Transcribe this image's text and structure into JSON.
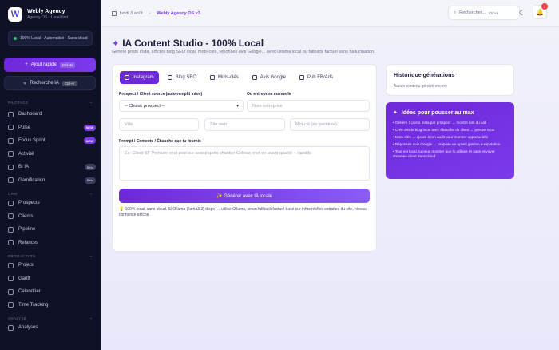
{
  "brand": {
    "logo_letter": "W",
    "name": "Webly Agency",
    "subtitle": "Agency OS · Local first"
  },
  "sidebar": {
    "status_pill": "100% Local · Automatisé · Sans cloud",
    "quick_add": {
      "label": "Ajout rapide",
      "shortcut": "Ctrl+N"
    },
    "ai_search": {
      "label": "Recherche IA",
      "shortcut": "Ctrl+K"
    },
    "sections": [
      {
        "title": "PILOTAGE",
        "items": [
          {
            "label": "Dashboard",
            "badge": ""
          },
          {
            "label": "Pulse",
            "badge": "NEW"
          },
          {
            "label": "Focus Sprint",
            "badge": "NEW"
          },
          {
            "label": "Activité",
            "badge": ""
          },
          {
            "label": "BI IA",
            "badge": "Bêta"
          },
          {
            "label": "Gamification",
            "badge": "Bêta"
          }
        ]
      },
      {
        "title": "CRM",
        "items": [
          {
            "label": "Prospects"
          },
          {
            "label": "Clients"
          },
          {
            "label": "Pipeline"
          },
          {
            "label": "Relances"
          }
        ]
      },
      {
        "title": "PRODUCTION",
        "items": [
          {
            "label": "Projets"
          },
          {
            "label": "Gantt"
          },
          {
            "label": "Calendrier"
          },
          {
            "label": "Time Tracking"
          }
        ]
      },
      {
        "title": "ANALYSE",
        "items": [
          {
            "label": "Analyses"
          }
        ]
      }
    ]
  },
  "topbar": {
    "date": "lundi 3 août",
    "separator": "•",
    "app": "Webly Agency OS v3",
    "search": {
      "label": "Rechercher...",
      "shortcut": "Ctrl+K"
    },
    "notification_count": "1"
  },
  "page": {
    "title": "IA Content Studio - 100% Local",
    "subtitle": "Génère posts Insta, articles blog SEO local, mots-clés, réponses avis Google... avec Ollama local ou fallback factuel sans hallucination."
  },
  "form": {
    "tabs": [
      {
        "label": "Instagram",
        "active": true
      },
      {
        "label": "Blog SEO",
        "active": false
      },
      {
        "label": "Mots-clés",
        "active": false
      },
      {
        "label": "Avis Google",
        "active": false
      },
      {
        "label": "Pub FB/Ads",
        "active": false
      }
    ],
    "prospect_label": "Prospect / Client source (auto-remplit infos)",
    "prospect_value": "-- Choisir prospect --",
    "manual_label": "Ou entreprise manuelle",
    "manual_placeholder": "Nom entreprise",
    "city_placeholder": "Ville",
    "website_placeholder": "Site web",
    "keyword_placeholder": "Mot-clé (ex: peinture)",
    "prompt_label": "Prompt / Contexte / Ébauche que tu fournis",
    "prompt_placeholder": "Ex: Client SF Peinture veut post sur avant/après chantier Colmar, met en avant qualité + rapidité",
    "generate_label": "✨ Générer avec IA locale",
    "note_icon": "💡",
    "note": "100% local, sans cloud. Si Ollama (llama3.2) dispo → utilise Ollama, sinon fallback factuel basé sur infos réelles extraites du site, niveau confiance affiché."
  },
  "history": {
    "title": "Historique générations",
    "empty": "Aucun contenu généré encore"
  },
  "ideas": {
    "title": "Idées pour pousser au max",
    "items": [
      "• Génère 3 posts Insta par prospect → montre lors du call",
      "• Crée article blog local avec ébauche du client → preuve SEO",
      "• Mots-clés → ajoute à ton audit pour montrer opportunités",
      "• Réponses avis Google → propose en upsell gestion e-réputation",
      "• Tout est local, tu peux montrer que tu utilises IA sans envoyer données client dans cloud"
    ]
  },
  "colors": {
    "accent": "#7c3aed",
    "sidebar_bg": "#0f1226",
    "status_green": "#22c55e",
    "badge_red": "#ef4444"
  }
}
